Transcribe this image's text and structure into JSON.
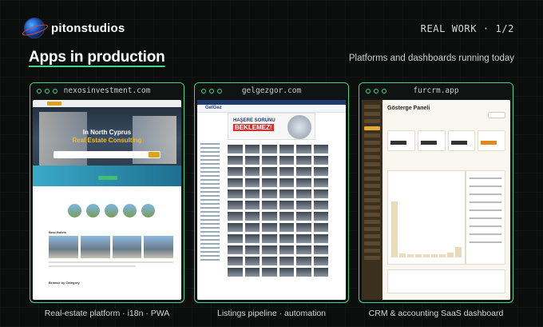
{
  "header": {
    "brand": "pitonstudios",
    "counter": "REAL WORK · 1/2"
  },
  "section": {
    "title": "Apps in production",
    "subtitle": "Platforms and dashboards running today"
  },
  "cards": [
    {
      "url": "nexosinvestment.com",
      "caption": "Real-estate platform · i18n · PWA",
      "hero_line1": "In North Cyprus",
      "hero_line2": "Real Estate Consulting",
      "section_label_1": "Best Hotels",
      "section_label_2": "Browse by Category"
    },
    {
      "url": "gelgezgor.com",
      "caption": "Listings pipeline · automation",
      "logo": "GelGez",
      "banner_line1": "HAŞERE SORUNU",
      "banner_line2": "BEKLEMEZ!"
    },
    {
      "url": "furcrm.app",
      "caption": "CRM & accounting SaaS dashboard",
      "panel_title": "Gösterge Paneli"
    }
  ],
  "colors": {
    "accent": "#3dd68c",
    "background": "#0c0e0d"
  }
}
